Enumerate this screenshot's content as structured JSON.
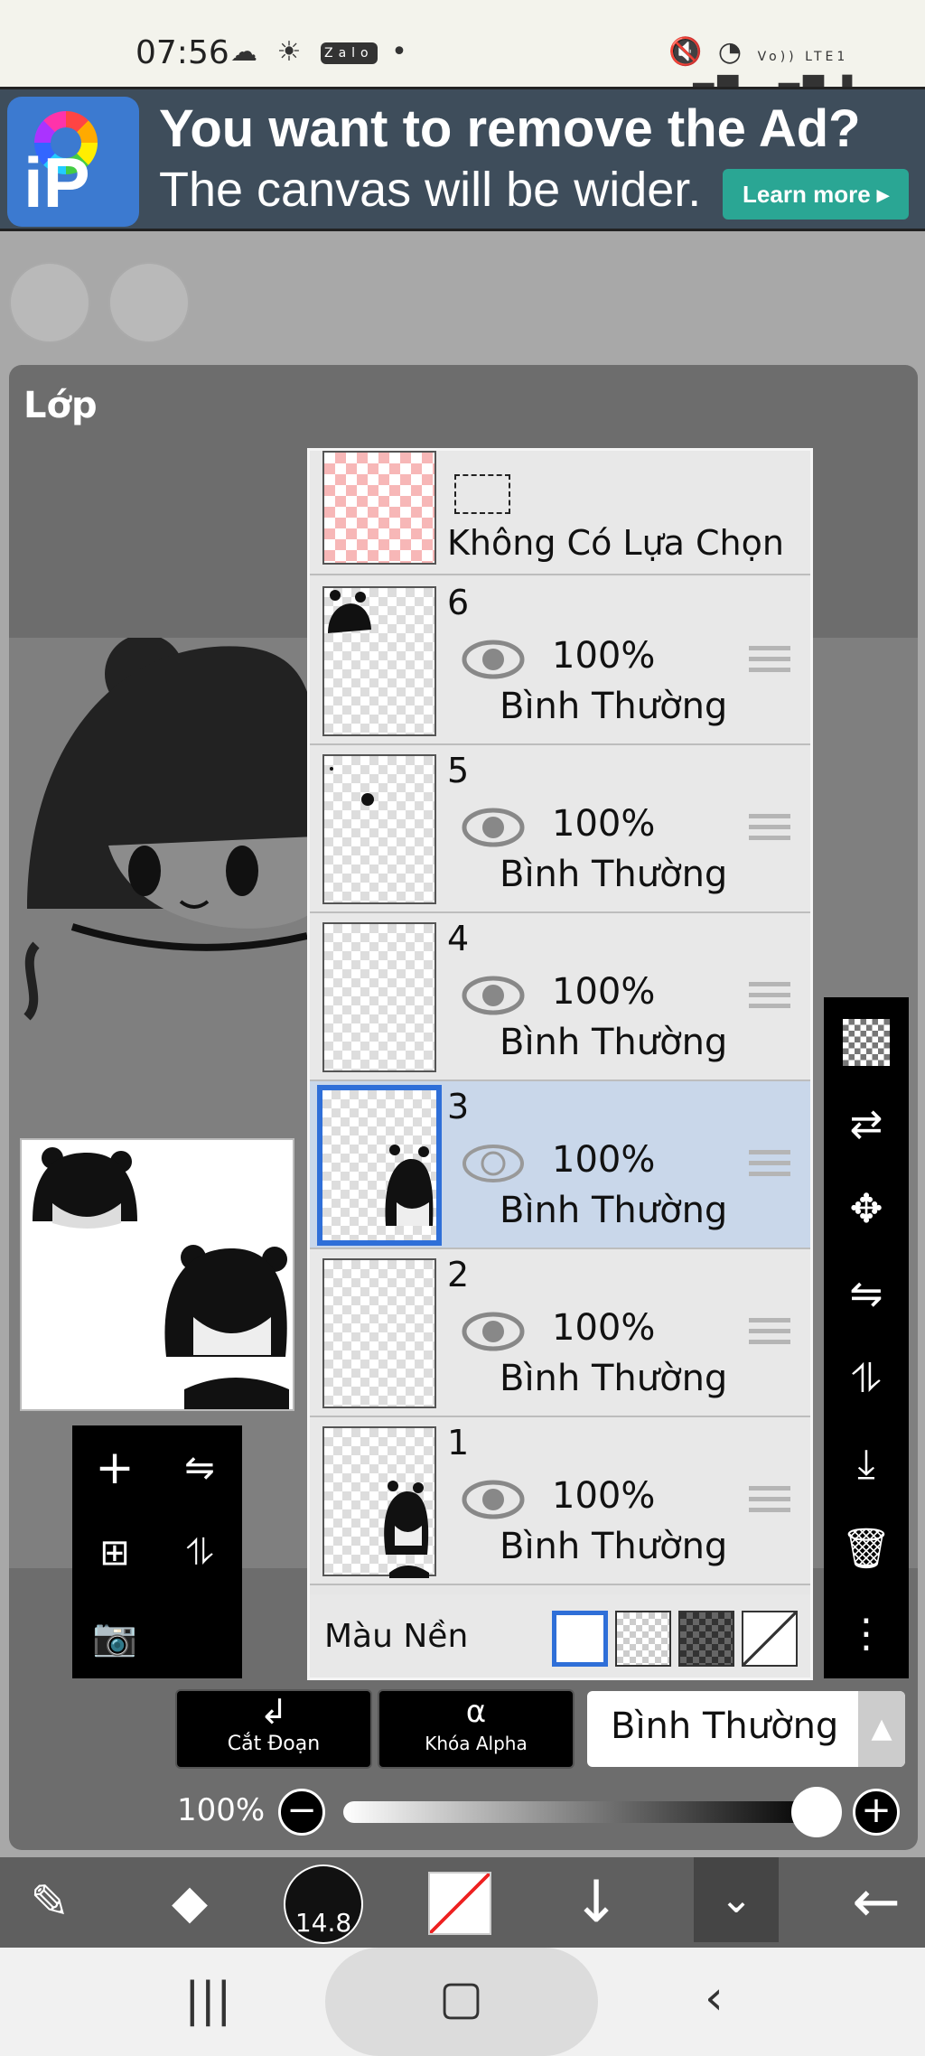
{
  "status_bar": {
    "time": "07:56",
    "left_icons": [
      "cloud-icon",
      "sun-icon",
      "zalo-icon",
      "dot-icon"
    ],
    "zalo_label": "Zalo",
    "right_icons": [
      "mute-icon",
      "wifi-icon",
      "volte-icon",
      "signal-icon",
      "signal-icon",
      "battery-icon"
    ],
    "volte_label": "Vo)) LTE1"
  },
  "ad": {
    "headline": "You want to remove the Ad?",
    "subline": "The canvas will be wider.",
    "button": "Learn more ▸",
    "logo_text": "iP"
  },
  "layer_panel": {
    "title": "Lớp",
    "selection_layer": {
      "label": "Không Có Lựa Chọn"
    },
    "layers": [
      {
        "number": "6",
        "opacity": "100%",
        "blend": "Bình Thường",
        "selected": false
      },
      {
        "number": "5",
        "opacity": "100%",
        "blend": "Bình Thường",
        "selected": false
      },
      {
        "number": "4",
        "opacity": "100%",
        "blend": "Bình Thường",
        "selected": false
      },
      {
        "number": "3",
        "opacity": "100%",
        "blend": "Bình Thường",
        "selected": true
      },
      {
        "number": "2",
        "opacity": "100%",
        "blend": "Bình Thường",
        "selected": false
      },
      {
        "number": "1",
        "opacity": "100%",
        "blend": "Bình Thường",
        "selected": false
      }
    ],
    "background": {
      "label": "Màu Nền",
      "options": [
        "white",
        "transparent",
        "dark-checker",
        "none"
      ],
      "selected": "white"
    }
  },
  "controls": {
    "clip_label": "Cắt Đoạn",
    "alpha_lock_label": "Khóa Alpha",
    "blend_mode": "Bình Thường",
    "opacity": "100%",
    "opacity_value": 1.0
  },
  "bottom_toolbar": {
    "brush_size": "14.8"
  },
  "colors": {
    "selected_row": "#c9d7ea",
    "selected_border": "#2f6fd8",
    "ad_button": "#2aa694"
  }
}
